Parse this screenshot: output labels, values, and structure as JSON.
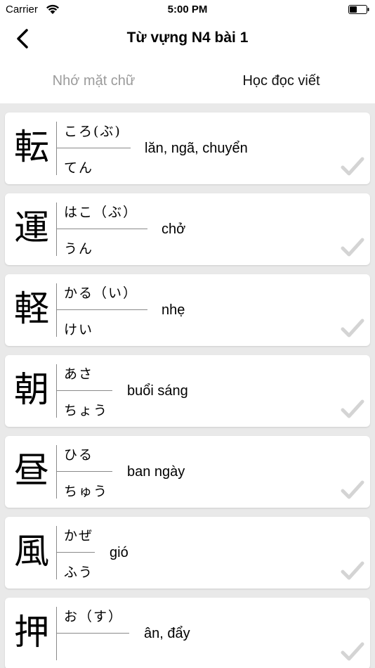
{
  "status_bar": {
    "carrier": "Carrier",
    "time": "5:00 PM"
  },
  "nav": {
    "title": "Từ vựng N4 bài 1",
    "back_icon": "chevron-left-icon"
  },
  "tabs": [
    {
      "label": "Nhớ mặt chữ",
      "active": false
    },
    {
      "label": "Học đọc viết",
      "active": true
    }
  ],
  "colors": {
    "list_background": "#e9e9e9",
    "inactive_tab": "#9b9b9b",
    "check_mark": "#d4d4d4"
  },
  "cards": [
    {
      "kanji": "転",
      "kun": "ころ(ぶ)",
      "on": "てん",
      "meaning": "lăn, ngã, chuyển"
    },
    {
      "kanji": "運",
      "kun": "はこ（ぶ）",
      "on": "うん",
      "meaning": "chở"
    },
    {
      "kanji": "軽",
      "kun": "かる（い）",
      "on": "けい",
      "meaning": "nhẹ"
    },
    {
      "kanji": "朝",
      "kun": "あさ",
      "on": "ちょう",
      "meaning": "buổi sáng"
    },
    {
      "kanji": "昼",
      "kun": "ひる",
      "on": "ちゅう",
      "meaning": "ban ngày"
    },
    {
      "kanji": "風",
      "kun": "かぜ",
      "on": "ふう",
      "meaning": "gió"
    },
    {
      "kanji": "押",
      "kun": "お（す）",
      "on": "",
      "meaning": "ân, đẩy"
    }
  ]
}
